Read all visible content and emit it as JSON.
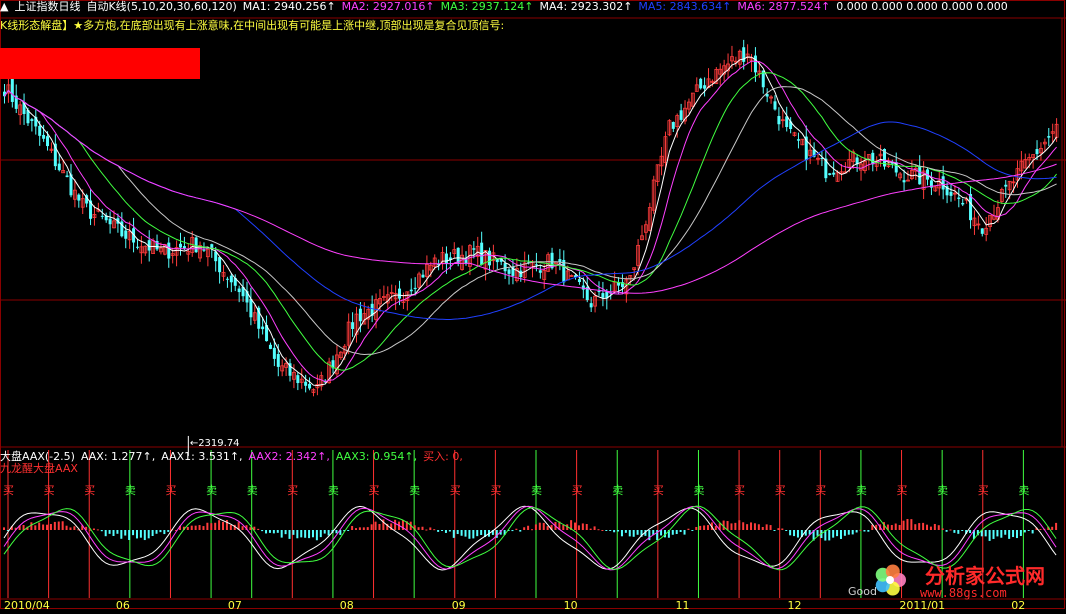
{
  "colors": {
    "up": "#ff3c3c",
    "down": "#54ffff",
    "ma1": "#ffffff",
    "ma2": "#ff40ff",
    "ma3": "#40ff40",
    "ma4": "#c8c8c8",
    "ma5": "#2040ff",
    "ma6": "#ff40ff",
    "grid": "#8a0000",
    "buy_signal": "#ff3030",
    "sell_signal": "#40ff40",
    "aax": "#ffffff",
    "aax2": "#ff40ff",
    "aax3": "#40ff40"
  },
  "header": {
    "title": "上证指数日线",
    "ma_label": "自动K线(5,10,20,30,60,120)",
    "ma_values": [
      {
        "name": "MA1:",
        "value": "2940.256↑",
        "color": "#ffffff"
      },
      {
        "name": "MA2:",
        "value": "2927.016↑",
        "color": "#ff40ff"
      },
      {
        "name": "MA3:",
        "value": "2937.124↑",
        "color": "#40ff40"
      },
      {
        "name": "MA4:",
        "value": "2923.302↑",
        "color": "#ffffff"
      },
      {
        "name": "MA5:",
        "value": "2843.634↑",
        "color": "#2040ff"
      },
      {
        "name": "MA6:",
        "value": "2877.524↑",
        "color": "#ff40ff"
      },
      {
        "name": "",
        "value": "0.000  0.000  0.000  0.000  0.000",
        "color": "#ffffff"
      }
    ],
    "tips": "K线形态解盘】★多方炮,在底部出现有上涨意味,在中间出现有可能是上涨中继,顶部出现是复合见顶信号:"
  },
  "low_label": "←2319.74",
  "indicator_header": {
    "name": "大盘AAX(-2.5)",
    "values": [
      {
        "name": "AAX:",
        "value": "1.277↑,",
        "color": "#ffffff"
      },
      {
        "name": "AAX1:",
        "value": "3.531↑,",
        "color": "#ffffff"
      },
      {
        "name": "AAX2:",
        "value": "2.342↑,",
        "color": "#ff40ff"
      },
      {
        "name": "AAX3:",
        "value": "0.954↑,",
        "color": "#40ff40"
      },
      {
        "name": "买入:",
        "value": "0,",
        "color": "#ff3030"
      }
    ],
    "sub_title": "九龙醒大盘AAX"
  },
  "x_axis_labels": [
    "2010/04",
    "06",
    "07",
    "08",
    "09",
    "10",
    "11",
    "12",
    "2011/01",
    "02"
  ],
  "signals": [
    {
      "label": "买",
      "type": "buy"
    },
    {
      "label": "买",
      "type": "buy"
    },
    {
      "label": "买",
      "type": "buy"
    },
    {
      "label": "卖",
      "type": "sell"
    },
    {
      "label": "买",
      "type": "buy"
    },
    {
      "label": "卖",
      "type": "sell"
    },
    {
      "label": "卖",
      "type": "sell"
    },
    {
      "label": "买",
      "type": "buy"
    },
    {
      "label": "卖",
      "type": "sell"
    },
    {
      "label": "买",
      "type": "buy"
    },
    {
      "label": "卖",
      "type": "sell"
    },
    {
      "label": "买",
      "type": "buy"
    },
    {
      "label": "买",
      "type": "buy"
    },
    {
      "label": "卖",
      "type": "sell"
    },
    {
      "label": "买",
      "type": "buy"
    },
    {
      "label": "卖",
      "type": "sell"
    },
    {
      "label": "买",
      "type": "buy"
    },
    {
      "label": "卖",
      "type": "sell"
    },
    {
      "label": "买",
      "type": "buy"
    },
    {
      "label": "买",
      "type": "buy"
    },
    {
      "label": "买",
      "type": "buy"
    },
    {
      "label": "卖",
      "type": "sell"
    },
    {
      "label": "买",
      "type": "buy"
    },
    {
      "label": "卖",
      "type": "sell"
    },
    {
      "label": "买",
      "type": "buy"
    },
    {
      "label": "卖",
      "type": "sell"
    }
  ],
  "logo": {
    "text": "分析家公式网",
    "url": "www.88gs.com"
  },
  "watermark": "Good",
  "chart_data": {
    "type": "candlestick",
    "ylim": [
      2300,
      3200
    ],
    "anchors": {
      "x_index": [
        0,
        10,
        20,
        30,
        40,
        50,
        60,
        70,
        80,
        90,
        100,
        110,
        120,
        130,
        140,
        150,
        160,
        170,
        180,
        190,
        200,
        210,
        220,
        230,
        240,
        250,
        260,
        270
      ],
      "close": [
        3080,
        2960,
        2820,
        2760,
        2720,
        2740,
        2640,
        2470,
        2420,
        2580,
        2620,
        2700,
        2720,
        2680,
        2700,
        2610,
        2660,
        2990,
        3100,
        3160,
        2980,
        2900,
        2930,
        2890,
        2870,
        2780,
        2900,
        3000
      ]
    },
    "ma_windows": [
      5,
      10,
      20,
      30,
      60,
      120
    ],
    "low": 2319.74
  }
}
